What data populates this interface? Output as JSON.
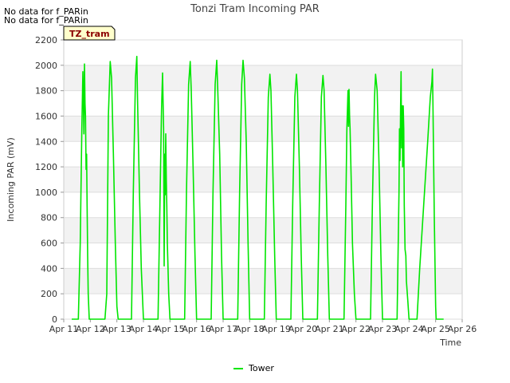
{
  "notes": [
    "No data for f_PARin",
    "No data for f_PARin"
  ],
  "chart_data": {
    "type": "line",
    "title": "Tonzi Tram Incoming PAR",
    "xlabel": "Time",
    "ylabel": "Incoming PAR (mV)",
    "tag": "TZ_tram",
    "ylim": [
      0,
      2200
    ],
    "yticks": [
      0,
      200,
      400,
      600,
      800,
      1000,
      1200,
      1400,
      1600,
      1800,
      2000,
      2200
    ],
    "xlim": [
      11,
      26
    ],
    "xticks": [
      {
        "v": 11,
        "label": "Apr 11"
      },
      {
        "v": 12,
        "label": "Apr 12"
      },
      {
        "v": 13,
        "label": "Apr 13"
      },
      {
        "v": 14,
        "label": "Apr 14"
      },
      {
        "v": 15,
        "label": "Apr 15"
      },
      {
        "v": 16,
        "label": "Apr 16"
      },
      {
        "v": 17,
        "label": "Apr 17"
      },
      {
        "v": 18,
        "label": "Apr 18"
      },
      {
        "v": 19,
        "label": "Apr 19"
      },
      {
        "v": 20,
        "label": "Apr 20"
      },
      {
        "v": 21,
        "label": "Apr 21"
      },
      {
        "v": 22,
        "label": "Apr 22"
      },
      {
        "v": 23,
        "label": "Apr 23"
      },
      {
        "v": 24,
        "label": "Apr 24"
      },
      {
        "v": 25,
        "label": "Apr 25"
      },
      {
        "v": 26,
        "label": "Apr 26"
      }
    ],
    "grid": true,
    "legend": "bottom-center",
    "series": [
      {
        "name": "Tower",
        "color": "#00e600",
        "x": [
          11.3,
          11.5,
          11.55,
          11.62,
          11.68,
          11.72,
          11.76,
          11.78,
          11.8,
          11.82,
          11.84,
          11.86,
          11.88,
          11.9,
          11.92,
          11.96,
          12.0,
          12.05,
          12.5,
          12.55,
          12.62,
          12.68,
          12.75,
          12.8,
          12.87,
          12.94,
          13.0,
          13.05,
          13.5,
          13.55,
          13.62,
          13.7,
          13.75,
          13.78,
          13.85,
          13.92,
          14.0,
          14.05,
          14.5,
          14.55,
          14.62,
          14.68,
          14.72,
          14.74,
          14.76,
          14.78,
          14.8,
          14.82,
          14.84,
          14.86,
          14.88,
          14.9,
          14.95,
          15.0,
          15.05,
          15.5,
          15.55,
          15.62,
          15.7,
          15.76,
          15.8,
          15.87,
          15.94,
          16.0,
          16.05,
          16.5,
          16.55,
          16.62,
          16.7,
          16.76,
          16.8,
          16.87,
          16.94,
          17.0,
          17.05,
          17.5,
          17.55,
          17.62,
          17.7,
          17.75,
          17.8,
          17.87,
          17.94,
          18.0,
          18.05,
          18.5,
          18.55,
          18.62,
          18.7,
          18.76,
          18.8,
          18.87,
          18.94,
          19.0,
          19.05,
          19.5,
          19.55,
          19.62,
          19.7,
          19.76,
          19.8,
          19.87,
          19.94,
          20.0,
          20.05,
          20.5,
          20.55,
          20.62,
          20.7,
          20.76,
          20.8,
          20.87,
          20.94,
          21.0,
          21.05,
          21.5,
          21.55,
          21.62,
          21.66,
          21.7,
          21.72,
          21.74,
          21.76,
          21.78,
          21.82,
          21.87,
          21.94,
          22.0,
          22.05,
          22.5,
          22.55,
          22.62,
          22.7,
          22.74,
          22.8,
          22.87,
          22.94,
          23.0,
          23.05,
          23.5,
          23.55,
          23.62,
          23.64,
          23.66,
          23.68,
          23.7,
          23.72,
          23.74,
          23.76,
          23.78,
          23.8,
          23.82,
          23.85,
          23.88,
          23.9,
          23.95,
          24.0,
          24.05,
          24.3,
          24.4,
          24.55,
          24.7,
          24.8,
          24.86,
          24.88,
          24.9,
          24.95,
          25.0,
          25.02,
          25.05,
          25.3
        ],
        "y": [
          0,
          0,
          0,
          600,
          1500,
          1950,
          1460,
          2010,
          1700,
          1600,
          1180,
          1300,
          900,
          500,
          200,
          0,
          0,
          0,
          0,
          0,
          200,
          1600,
          2030,
          1900,
          1300,
          600,
          100,
          0,
          0,
          0,
          1000,
          1900,
          2070,
          1700,
          1000,
          400,
          0,
          0,
          0,
          0,
          900,
          1650,
          1940,
          1700,
          1500,
          420,
          1300,
          980,
          1460,
          1100,
          900,
          600,
          200,
          0,
          0,
          0,
          0,
          1000,
          1850,
          2030,
          1800,
          1200,
          500,
          0,
          0,
          0,
          0,
          1000,
          1850,
          2040,
          1800,
          1300,
          500,
          0,
          0,
          0,
          0,
          1000,
          1850,
          2040,
          1900,
          1400,
          600,
          0,
          0,
          0,
          0,
          900,
          1750,
          1930,
          1800,
          1200,
          500,
          0,
          0,
          0,
          0,
          900,
          1750,
          1930,
          1800,
          1200,
          500,
          0,
          0,
          0,
          0,
          900,
          1750,
          1920,
          1800,
          1200,
          500,
          0,
          0,
          0,
          0,
          900,
          1500,
          1800,
          1520,
          1810,
          1600,
          1500,
          1100,
          600,
          200,
          0,
          0,
          0,
          0,
          900,
          1750,
          1930,
          1800,
          1200,
          500,
          0,
          0,
          0,
          0,
          1000,
          1500,
          1250,
          1670,
          1950,
          1350,
          1680,
          1200,
          1680,
          1500,
          900,
          550,
          500,
          300,
          150,
          0,
          0,
          0,
          400,
          900,
          1400,
          1750,
          1870,
          1970,
          1700,
          800,
          100,
          0,
          0,
          0
        ]
      }
    ]
  }
}
